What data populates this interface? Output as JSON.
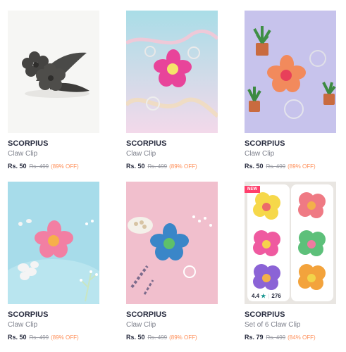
{
  "products": [
    {
      "brand": "SCORPIUS",
      "name": "Claw Clip",
      "price": "Rs. 50",
      "mrp": "Rs. 499",
      "discount": "(89% OFF)"
    },
    {
      "brand": "SCORPIUS",
      "name": "Claw Clip",
      "price": "Rs. 50",
      "mrp": "Rs. 499",
      "discount": "(89% OFF)"
    },
    {
      "brand": "SCORPIUS",
      "name": "Claw Clip",
      "price": "Rs. 50",
      "mrp": "Rs. 499",
      "discount": "(89% OFF)"
    },
    {
      "brand": "SCORPIUS",
      "name": "Claw Clip",
      "price": "Rs. 50",
      "mrp": "Rs. 499",
      "discount": "(89% OFF)"
    },
    {
      "brand": "SCORPIUS",
      "name": "Claw Clip",
      "price": "Rs. 50",
      "mrp": "Rs. 499",
      "discount": "(89% OFF)"
    },
    {
      "brand": "SCORPIUS",
      "name": "Set of 6 Claw Clip",
      "price": "Rs. 79",
      "mrp": "Rs. 499",
      "discount": "(84% OFF)",
      "badge": "NEW",
      "rating": "4.4",
      "rating_count": "276"
    }
  ],
  "colors": {
    "discount": "#ff905a",
    "brand_text": "#282c3f",
    "rating_star": "#14958f",
    "new_badge": "#ff3f6c"
  }
}
